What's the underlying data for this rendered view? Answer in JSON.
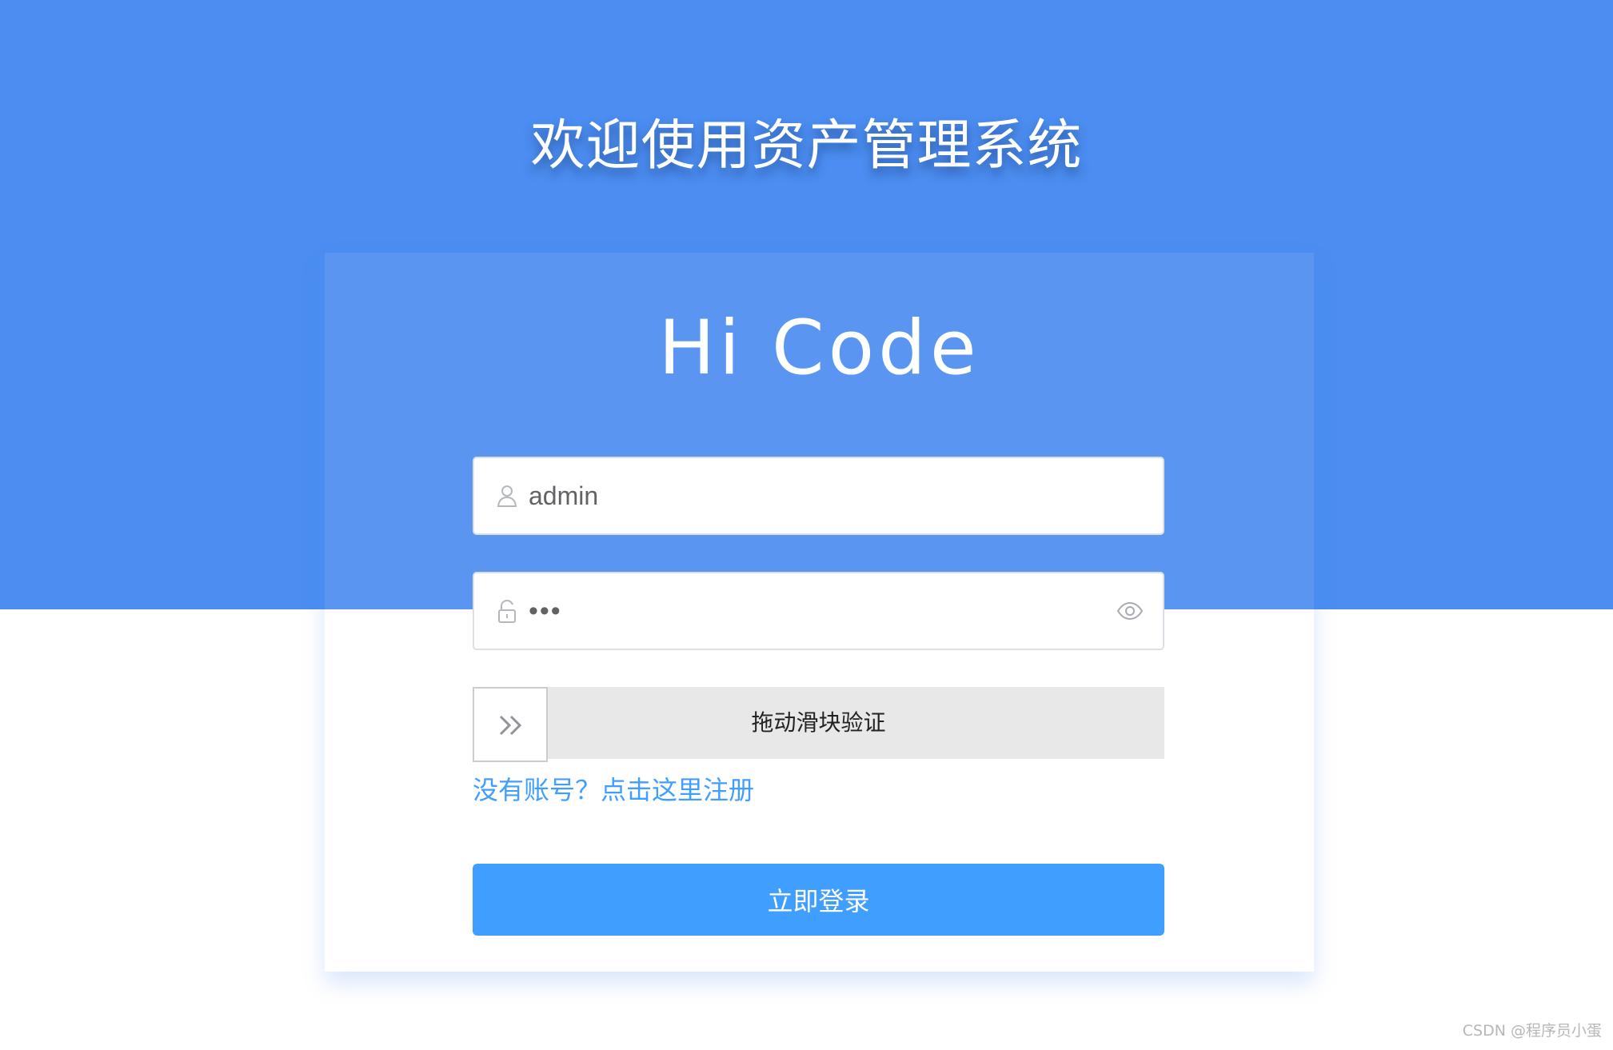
{
  "page": {
    "title": "欢迎使用资产管理系统",
    "watermark": "CSDN @程序员小蛋"
  },
  "login": {
    "brand": "Hi Code",
    "username": {
      "value": "admin",
      "icon": "user-icon"
    },
    "password": {
      "value": "123",
      "icon": "unlock-icon",
      "toggle_icon": "eye-icon"
    },
    "slider": {
      "label": "拖动滑块验证",
      "icon": "double-chevron-right-icon"
    },
    "register_link": "没有账号？点击这里注册",
    "submit_label": "立即登录"
  },
  "colors": {
    "header_background": "#4b8df0",
    "primary": "#409eff",
    "slider_track": "#e8e8e8"
  }
}
